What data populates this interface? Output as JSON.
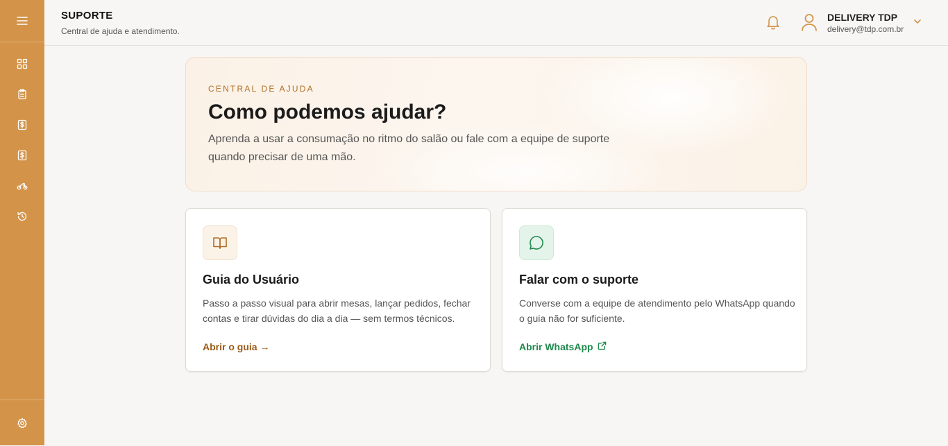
{
  "app": {
    "accent": "#d3944a",
    "link_color": "#9a5a18",
    "whatsapp_color": "#1f8a4c"
  },
  "sidebar": {
    "menu_icon": "hamburger-menu-icon",
    "items": [
      {
        "icon": "dashboard-grid-icon"
      },
      {
        "icon": "clipboard-icon"
      },
      {
        "icon": "dollar-receipt-icon"
      },
      {
        "icon": "dollar-receipt-alt-icon"
      },
      {
        "icon": "motorcycle-icon"
      },
      {
        "icon": "history-icon"
      }
    ],
    "settings_icon": "gear-icon"
  },
  "header": {
    "title": "SUPORTE",
    "subtitle": "Central de ajuda e atendimento.",
    "user": {
      "name": "DELIVERY TDP",
      "email": "delivery@tdp.com.br"
    }
  },
  "hero": {
    "eyebrow": "CENTRAL DE AJUDA",
    "title": "Como podemos ajudar?",
    "description": "Aprenda a usar a consumação no ritmo do salão ou fale com a equipe de suporte quando precisar de uma mão."
  },
  "cards": [
    {
      "icon": "book-icon",
      "title": "Guia do Usuário",
      "description": "Passo a passo visual para abrir mesas, lançar pedidos, fechar contas e tirar dúvidas do dia a dia — sem termos técnicos.",
      "link": "Abrir o guia →"
    },
    {
      "icon": "chat-bubble-icon",
      "title": "Falar com o suporte",
      "description": "Converse com a equipe de atendimento pelo WhatsApp quando o guia não for suficiente.",
      "link": "Abrir WhatsApp"
    }
  ]
}
